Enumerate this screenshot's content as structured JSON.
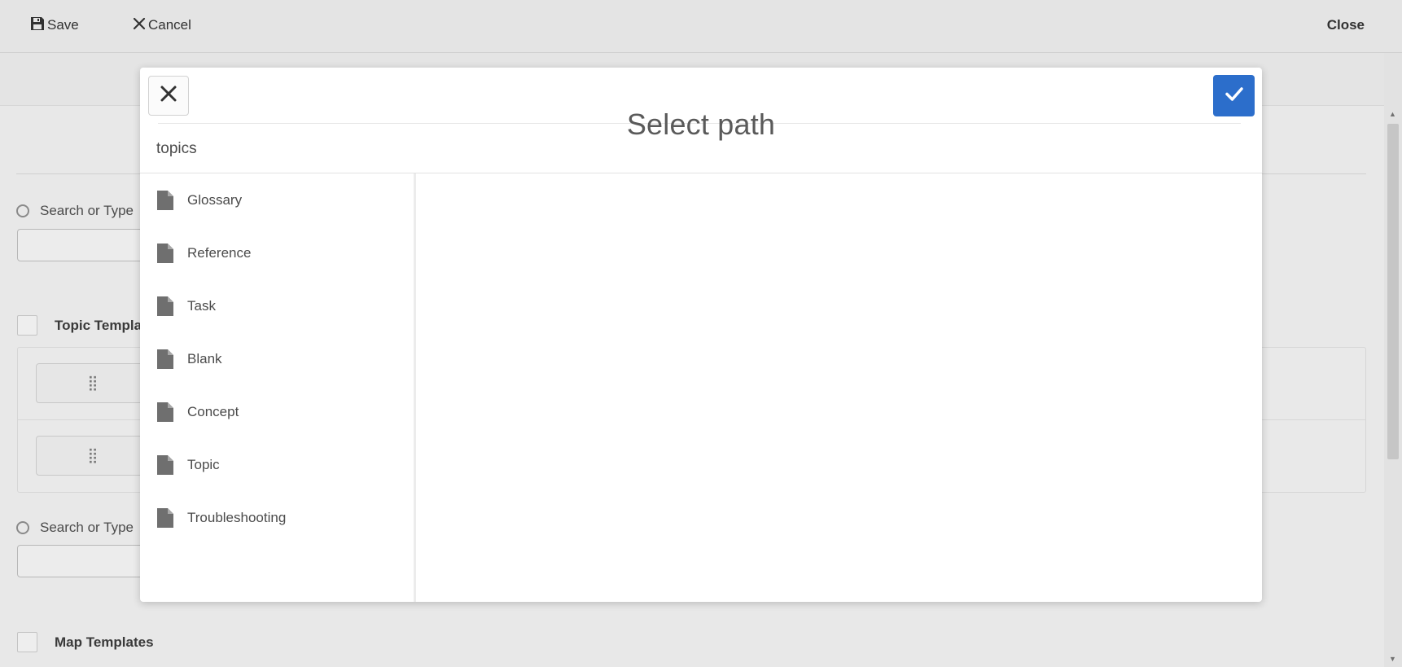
{
  "toolbar": {
    "save": "Save",
    "cancel": "Cancel",
    "close": "Close"
  },
  "background": {
    "radio_1_label": "Search or Type",
    "radio_2_label": "Search or Type",
    "topic_templates_label": "Topic Templa",
    "map_templates_label": "Map Templates"
  },
  "modal": {
    "title": "Select path",
    "breadcrumb": "topics",
    "items": [
      {
        "label": "Glossary",
        "icon": "document-icon"
      },
      {
        "label": "Reference",
        "icon": "document-icon"
      },
      {
        "label": "Task",
        "icon": "document-icon"
      },
      {
        "label": "Blank",
        "icon": "document-icon"
      },
      {
        "label": "Concept",
        "icon": "document-icon"
      },
      {
        "label": "Topic",
        "icon": "document-icon"
      },
      {
        "label": "Troubleshooting",
        "icon": "document-icon"
      }
    ]
  },
  "colors": {
    "accent": "#2c6ecb",
    "toolbar_bg": "#e4e4e4",
    "modal_bg": "#ffffff"
  }
}
